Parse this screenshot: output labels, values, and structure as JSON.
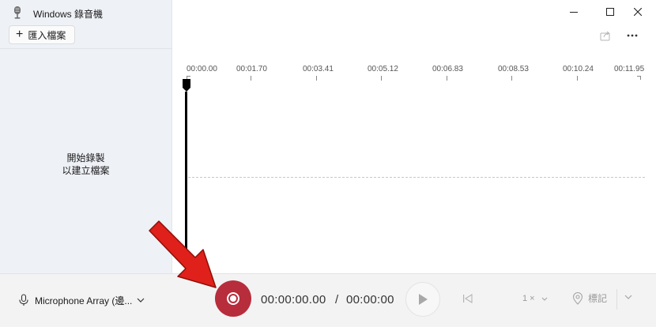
{
  "window": {
    "title": "Windows 錄音機",
    "icon": "microphone-app-icon",
    "controls": [
      "minimize-icon",
      "maximize-icon",
      "close-icon"
    ]
  },
  "sidebar": {
    "import_label": "匯入檔案",
    "empty_line1": "開始錄製",
    "empty_line2": "以建立檔案"
  },
  "toolbar": {
    "share_icon": "share-icon",
    "more_icon": "more-options-icon"
  },
  "timeline": {
    "ticks": [
      "00:00.00",
      "00:01.70",
      "00:03.41",
      "00:05.12",
      "00:06.83",
      "00:08.53",
      "00:10.24",
      "00:11.95"
    ]
  },
  "bottom": {
    "mic_label": "Microphone Array (邊...",
    "current_time": "00:00:00.00",
    "separator": "/",
    "total_time": "00:00:00",
    "speed_value": "1",
    "speed_suffix": "×",
    "mark_label": "標記"
  },
  "colors": {
    "record": "#b72d3b",
    "annotation_arrow": "#e0201a"
  }
}
